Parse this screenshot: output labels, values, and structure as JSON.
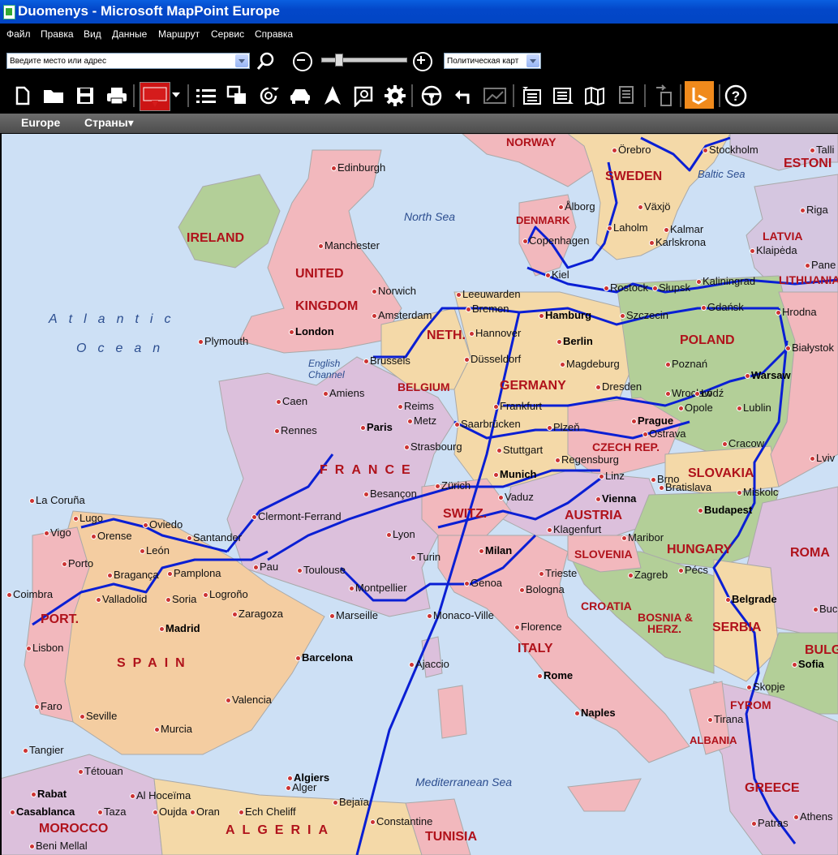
{
  "window": {
    "title": "Duomenys - Microsoft MapPoint Europe"
  },
  "menu": [
    "Файл",
    "Правка",
    "Вид",
    "Данные",
    "Маршрут",
    "Сервис",
    "Справка"
  ],
  "search": {
    "placeholder": "Введите место или адрес",
    "value": "Введите место или адрес"
  },
  "zoom": {
    "level_fraction": 0.18
  },
  "map_style": {
    "value": "Политическая карт"
  },
  "toolbar_icons": [
    "new-document-icon",
    "open-folder-icon",
    "save-icon",
    "print-icon",
    "pushpin-icon",
    "list-icon",
    "shapes-icon",
    "locate-icon",
    "car-icon",
    "navigate-arrow-icon",
    "find-nearby-icon",
    "settings-icon",
    "steering-wheel-icon",
    "undo-icon",
    "chart-icon",
    "import-data-icon",
    "export-data-icon",
    "map-book-icon",
    "report-icon",
    "pocket-device-icon",
    "bing-icon",
    "help-icon"
  ],
  "nav": {
    "region": "Europe",
    "countries_menu": "Страны▾"
  },
  "colors": {
    "route": "#0a1fd4",
    "country_label": "#b0121b",
    "water": "#cde0f5"
  },
  "map": {
    "countries": [
      "NORWAY",
      "SWEDEN",
      "ESTONI",
      "LATVIA",
      "LITHUANIA",
      "DENMARK",
      "IRELAND",
      "UNITED",
      "KINGDOM",
      "NETH.",
      "POLAND",
      "BELGIUM",
      "GERMANY",
      "CZECH REP.",
      "SLOVAKIA",
      "FRANCE",
      "SWITZ.",
      "AUSTRIA",
      "HUNGARY",
      "ROMA",
      "SLOVENIA",
      "CROATIA",
      "BOSNIA &",
      "HERZ.",
      "SERBIA",
      "BULG",
      "PORT.",
      "SPAIN",
      "ITALY",
      "FYROM",
      "ALBANIA",
      "GREECE",
      "MOROCCO",
      "ALGERIA",
      "TUNISIA"
    ],
    "seas": [
      "North Sea",
      "Baltic Sea",
      "Atlantic",
      "Ocean",
      "English",
      "Channel",
      "Mediterranean Sea"
    ],
    "cities": [
      "Örebro",
      "Stockholm",
      "Talli",
      "Edinburgh",
      "Riga",
      "Ålborg",
      "Växjö",
      "Kalmar",
      "Karlskrona",
      "Copenhagen",
      "Laholm",
      "Klaipėda",
      "Pane",
      "Manchester",
      "Kiel",
      "Rostock",
      "Słupsk",
      "Kaliningrad",
      "Norwich",
      "Leeuwarden",
      "Bremen",
      "Hamburg",
      "Szczecin",
      "Gdańsk",
      "Hrodna",
      "Amsterdam",
      "London",
      "Hannover",
      "Berlin",
      "Białystok",
      "Plymouth",
      "Brussels",
      "Düsseldorf",
      "Magdeburg",
      "Poznań",
      "Warsaw",
      "Caen",
      "Amiens",
      "Reims",
      "Frankfurt",
      "Dresden",
      "Wrocław",
      "Łódź",
      "Opole",
      "Lublin",
      "Paris",
      "Metz",
      "Saarbrücken",
      "Plzeň",
      "Prague",
      "Rennes",
      "Strasbourg",
      "Stuttgart",
      "Ostrava",
      "Cracow",
      "Regensburg",
      "Linz",
      "Brno",
      "Lviv",
      "Besançon",
      "Munich",
      "Vienna",
      "Bratislava",
      "Miskolc",
      "Zürich",
      "Vaduz",
      "La Coruña",
      "Lugo",
      "Oviedo",
      "Clermont-Ferrand",
      "Budapest",
      "Vigo",
      "Orense",
      "Santander",
      "Klagenfurt",
      "Maribor",
      "Lyon",
      "León",
      "Milan",
      "Porto",
      "Pamplona",
      "Pau",
      "Toulouse",
      "Turin",
      "Trieste",
      "Zagreb",
      "Pécs",
      "Bragança",
      "Valladolid",
      "Soria",
      "Logroño",
      "Montpellier",
      "Genoa",
      "Bologna",
      "Coimbra",
      "Zaragoza",
      "Belgrade",
      "Buchare",
      "Marseille",
      "Monaco-Ville",
      "Madrid",
      "Lisbon",
      "Florence",
      "Barcelona",
      "Ajaccio",
      "Sofia",
      "Rome",
      "Skopje",
      "Valencia",
      "Faro",
      "Seville",
      "Murcia",
      "Naples",
      "Tirana",
      "Tangier",
      "Tétouan",
      "Algiers",
      "Alger",
      "Rabat",
      "Al Hoceïma",
      "Casablanca",
      "Taza",
      "Oujda",
      "Oran",
      "Ech Cheliff",
      "Bejaïa",
      "Constantine",
      "Beni Mellal",
      "Patras",
      "Athens"
    ]
  }
}
